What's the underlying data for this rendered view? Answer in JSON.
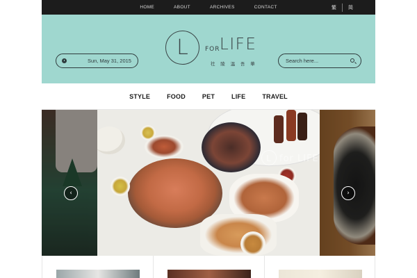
{
  "topnav": {
    "items": [
      "HOME",
      "ABOUT",
      "ARCHIVES",
      "CONTACT"
    ]
  },
  "lang": {
    "traditional": "繁",
    "simplified": "简"
  },
  "header": {
    "date": "Sun, May 31, 2015",
    "search_placeholder": "Search here...",
    "logo": {
      "letter": "L",
      "for": "FOR",
      "life": "LIFE",
      "tagline": "社 陵 温 吾 華"
    },
    "bg_color": "#9fd7cf"
  },
  "catnav": {
    "items": [
      "STYLE",
      "FOOD",
      "PET",
      "LIFE",
      "TRAVEL"
    ]
  },
  "slider": {
    "title": "",
    "watermark_letter": "L",
    "watermark_text": "for LIFE",
    "prev_label": "‹",
    "next_label": "›"
  },
  "icons": [
    "clock-icon",
    "search-icon",
    "chevron-left-icon",
    "chevron-right-icon"
  ]
}
